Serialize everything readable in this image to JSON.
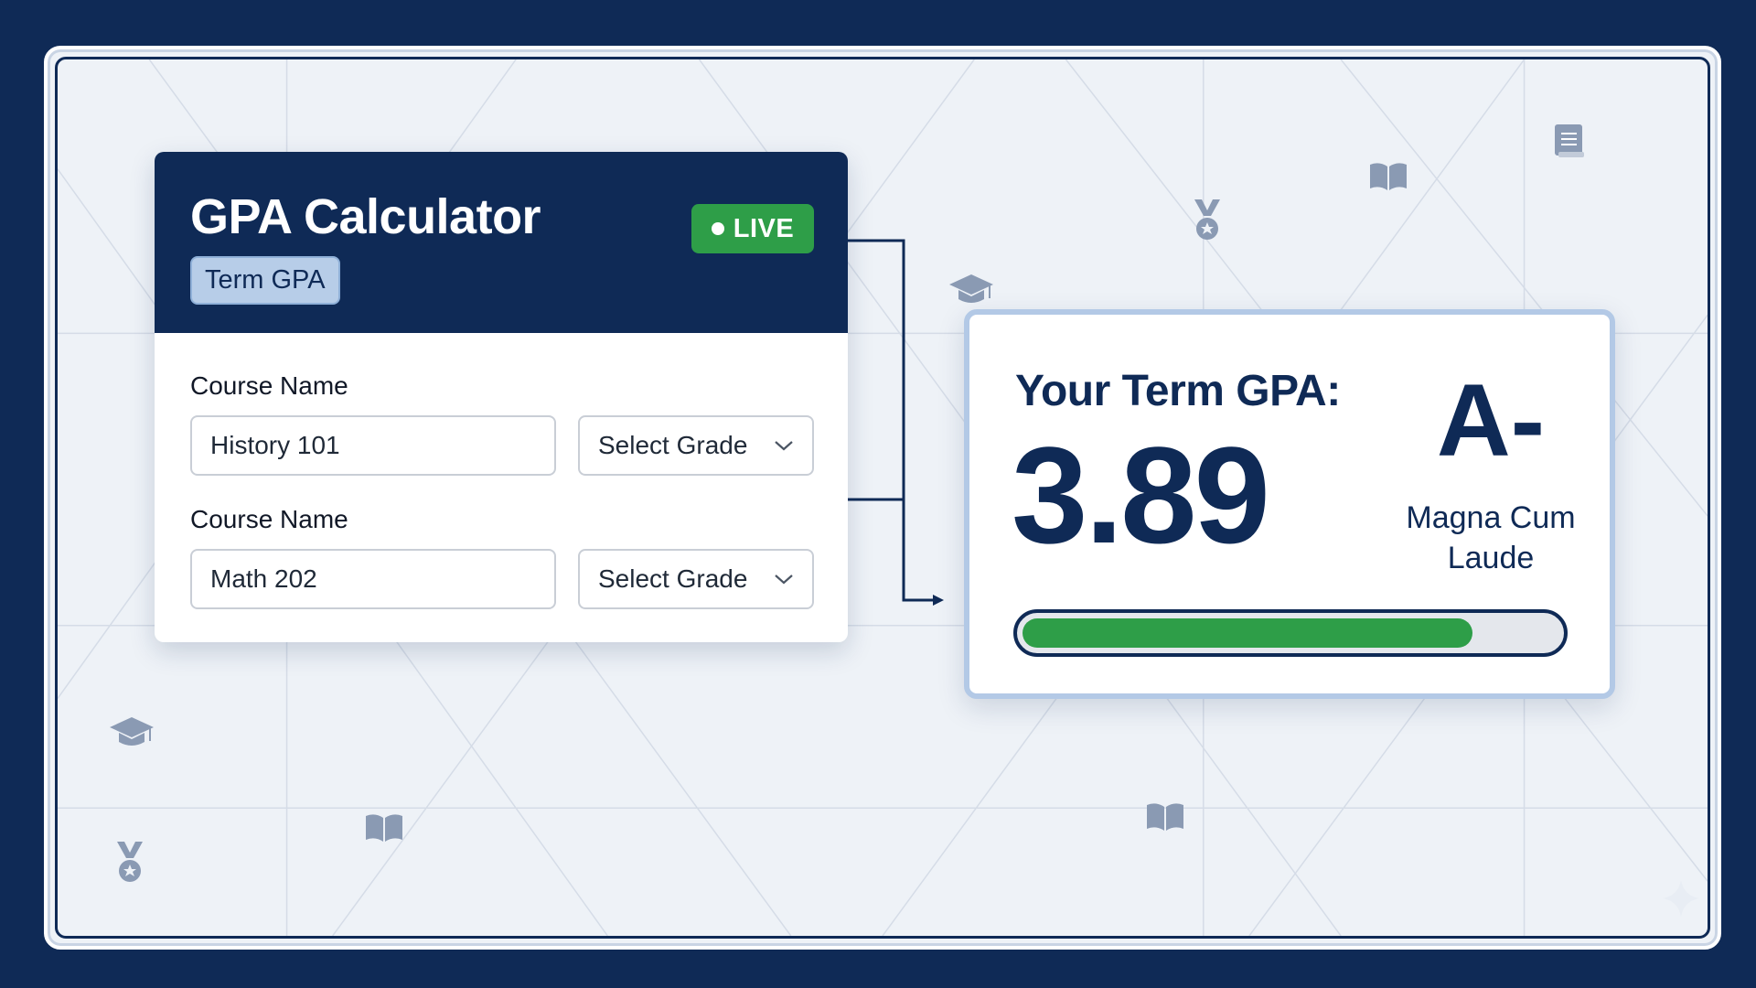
{
  "calculator": {
    "title": "GPA Calculator",
    "badge": "Term GPA",
    "live_label": "LIVE",
    "courses": [
      {
        "label": "Course Name",
        "value": "History 101",
        "grade_placeholder": "Select Grade"
      },
      {
        "label": "Course Name",
        "value": "Math 202",
        "grade_placeholder": "Select Grade"
      }
    ]
  },
  "result": {
    "label": "Your Term GPA:",
    "gpa": "3.89",
    "letter": "A-",
    "honor": "Magna Cum Laude",
    "progress_fraction": 0.84
  },
  "colors": {
    "navy": "#0f2a56",
    "live_green": "#2e9e48",
    "badge_blue": "#b7cde8",
    "background": "#eef2f7"
  },
  "icons": [
    "graduation-cap-icon",
    "medal-icon",
    "open-book-icon",
    "book-icon",
    "chevron-down-icon",
    "sparkle-icon"
  ]
}
